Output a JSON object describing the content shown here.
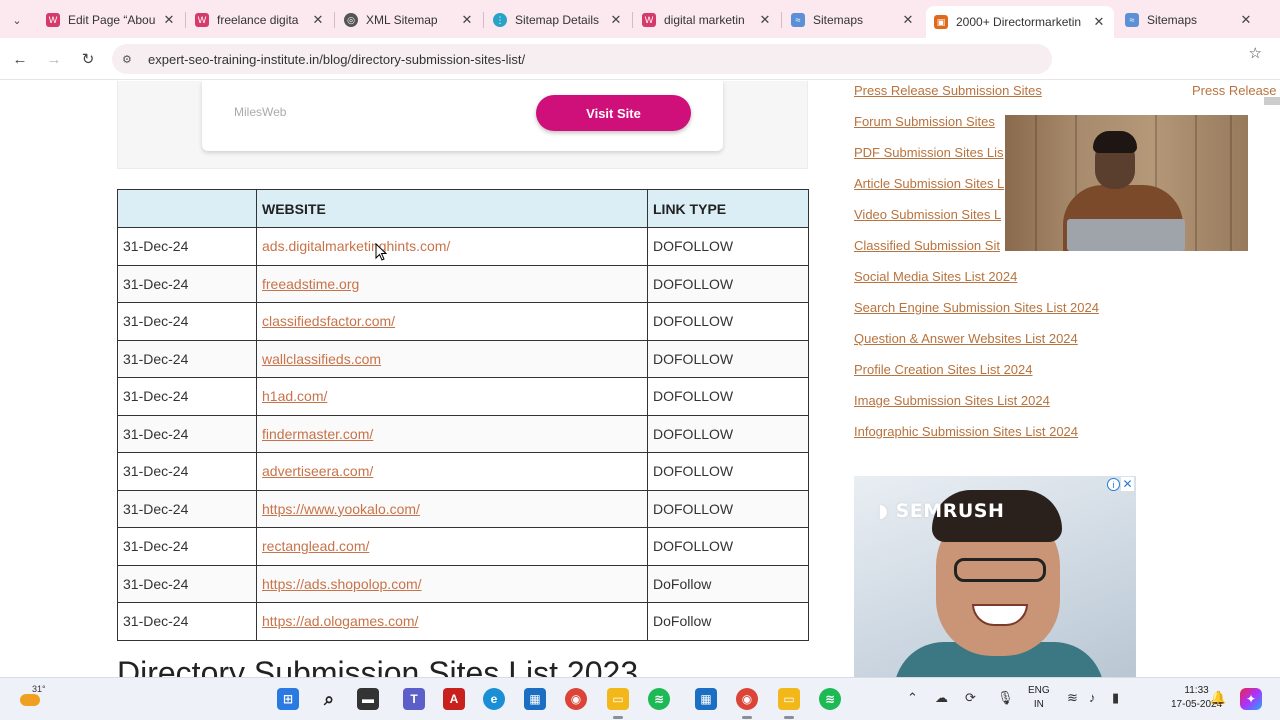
{
  "browser": {
    "tabs": [
      {
        "label": "Edit Page “Abou",
        "icon": "wordpress-pink-icon"
      },
      {
        "label": "freelance digita",
        "icon": "wordpress-pink-icon"
      },
      {
        "label": "XML Sitemap",
        "icon": "globe-icon"
      },
      {
        "label": "Sitemap Details",
        "icon": "sitemap-blue-icon"
      },
      {
        "label": "digital marketin",
        "icon": "wordpress-pink-icon"
      },
      {
        "label": "Sitemaps",
        "icon": "search-console-icon"
      },
      {
        "label": "2000+ Directormarketin",
        "icon": "site-orange-icon",
        "active": true
      },
      {
        "label": "Sitemaps",
        "icon": "search-console-icon"
      }
    ],
    "url": "expert-seo-training-institute.in/blog/directory-submission-sites-list/"
  },
  "ad_banner": {
    "brand": "MilesWeb",
    "button": "Visit Site"
  },
  "table": {
    "headers": [
      "",
      "WEBSITE",
      "LINK TYPE"
    ],
    "rows": [
      {
        "date": "31-Dec-24",
        "site": "ads.digitalmarketinghints.com/",
        "type": "DOFOLLOW",
        "underline": false
      },
      {
        "date": "31-Dec-24",
        "site": "freeadstime.org",
        "type": "DOFOLLOW",
        "underline": true
      },
      {
        "date": "31-Dec-24",
        "site": "classifiedsfactor.com/",
        "type": "DOFOLLOW",
        "underline": true
      },
      {
        "date": "31-Dec-24",
        "site": "wallclassifieds.com",
        "type": "DOFOLLOW",
        "underline": true
      },
      {
        "date": "31-Dec-24",
        "site": "h1ad.com/",
        "type": "DOFOLLOW",
        "underline": true
      },
      {
        "date": "31-Dec-24",
        "site": "findermaster.com/",
        "type": "DOFOLLOW",
        "underline": true
      },
      {
        "date": "31-Dec-24",
        "site": "advertiseera.com/",
        "type": "DOFOLLOW",
        "underline": true
      },
      {
        "date": "31-Dec-24",
        "site": "https://www.yookalo.com/",
        "type": "DOFOLLOW",
        "underline": true
      },
      {
        "date": "31-Dec-24",
        "site": "rectanglead.com/",
        "type": "DOFOLLOW",
        "underline": true
      },
      {
        "date": "31-Dec-24",
        "site": "https://ads.shopolop.com/",
        "type": "DoFollow",
        "underline": true
      },
      {
        "date": "31-Dec-24",
        "site": "https://ad.ologames.com/",
        "type": "DoFollow",
        "underline": true
      }
    ]
  },
  "next_heading": "Directory Submission Sites List 2023",
  "next_heading_right": "ist 2023",
  "sidebar": {
    "links": [
      "Press Release Submission Sites",
      "Forum Submission Sites",
      "PDF Submission Sites Lis",
      "Article Submission Sites L",
      "Video Submission Sites L",
      "Classified Submission Sit",
      "Social Media Sites List 2024",
      "Search Engine Submission Sites List 2024",
      "Question & Answer Websites List 2024",
      "Profile Creation Sites List 2024",
      "Image Submission Sites List 2024",
      "Infographic Submission Sites List 2024"
    ],
    "edge_link": "Press Release"
  },
  "semrush_ad": {
    "logo": "SEMRUSH",
    "info": "i",
    "close": "✕"
  },
  "taskbar": {
    "weather_temp": "31°",
    "lang_1": "ENG",
    "lang_2": "IN",
    "time": "11:33",
    "date": "17-05-2024"
  },
  "colors": {
    "tab_strip": "#fbe9ef",
    "link": "#c8734a",
    "table_header": "#dbeef5",
    "visit_button": "#d0107a"
  }
}
